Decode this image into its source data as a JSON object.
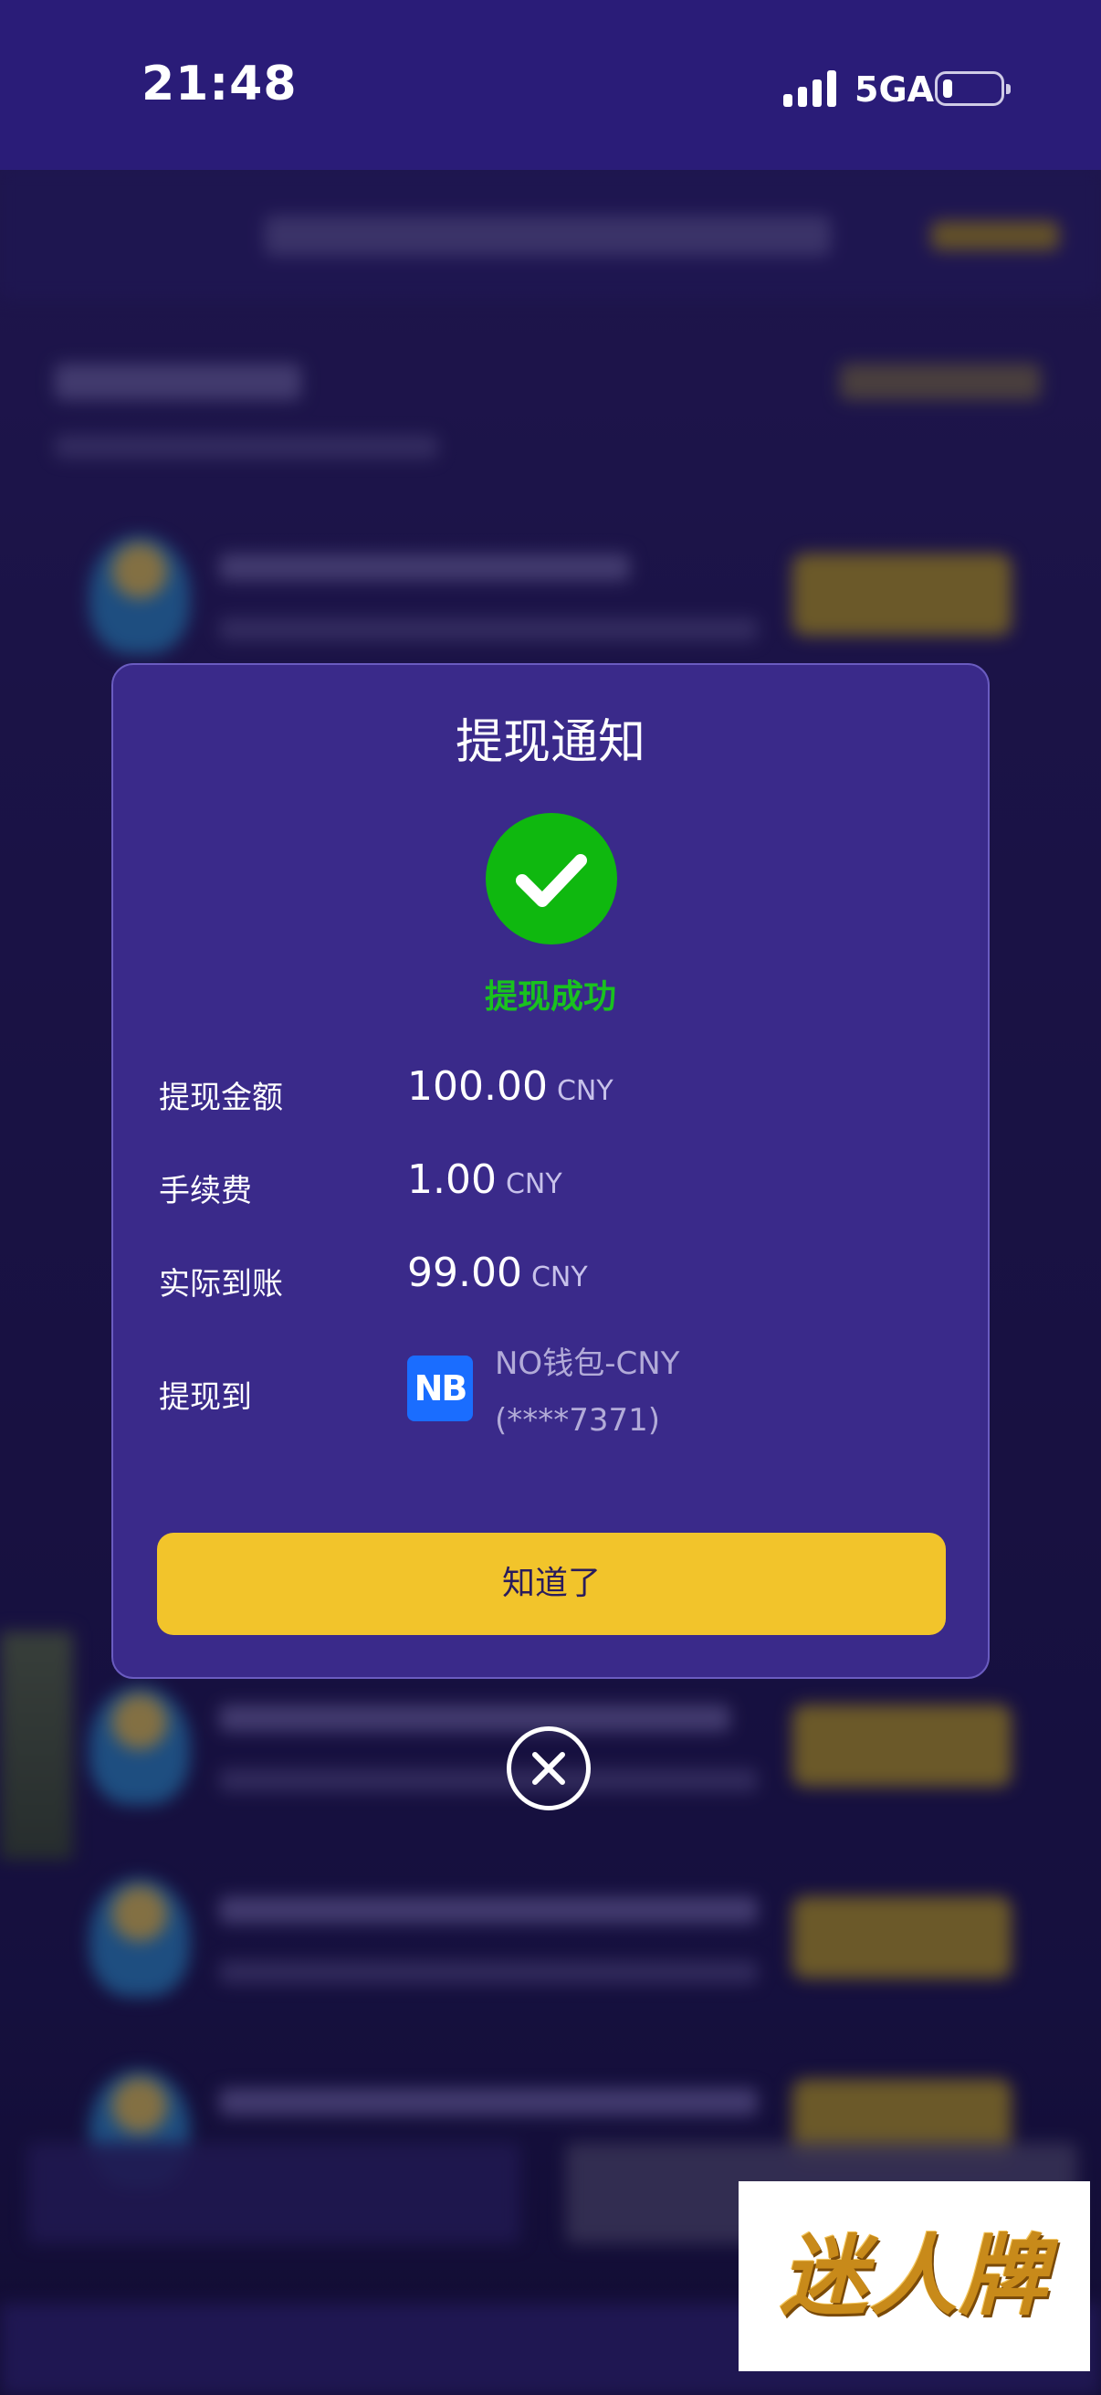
{
  "status_bar": {
    "time": "21:48",
    "network": "5GA",
    "battery_level": 0.15
  },
  "dialog": {
    "title": "提现通知",
    "status_text": "提现成功",
    "status_color": "#19c21e",
    "rows": [
      {
        "label": "提现金额",
        "value": "100.00",
        "unit": "CNY"
      },
      {
        "label": "手续费",
        "value": "1.00",
        "unit": "CNY"
      },
      {
        "label": "实际到账",
        "value": "99.00",
        "unit": "CNY"
      }
    ],
    "destination": {
      "label": "提现到",
      "wallet_icon": "NB",
      "wallet_name": "NO钱包-CNY",
      "account": "(****7371)"
    },
    "confirm_label": "知道了",
    "confirm_color": "#f2c42b"
  },
  "watermark": {
    "text": "迷人牌"
  }
}
